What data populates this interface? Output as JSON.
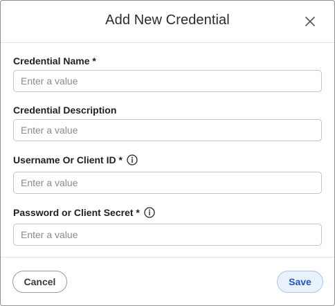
{
  "dialog": {
    "title": "Add New Credential",
    "close_label": "Close"
  },
  "fields": [
    {
      "label": "Credential Name *",
      "placeholder": "Enter a value",
      "value": ""
    },
    {
      "label": "Credential Description",
      "placeholder": "Enter a value",
      "value": ""
    },
    {
      "label": "Username Or Client ID *",
      "placeholder": "Enter a value",
      "value": "",
      "icon": "info-icon"
    },
    {
      "label": "Password or Client Secret *",
      "placeholder": "Enter a value",
      "value": "",
      "icon": "info-icon"
    }
  ],
  "footer": {
    "cancel_label": "Cancel",
    "save_label": "Save"
  },
  "colors": {
    "accent": "#1f57c3",
    "save_bg": "#e9f1fd",
    "border": "#c4c4c4"
  }
}
